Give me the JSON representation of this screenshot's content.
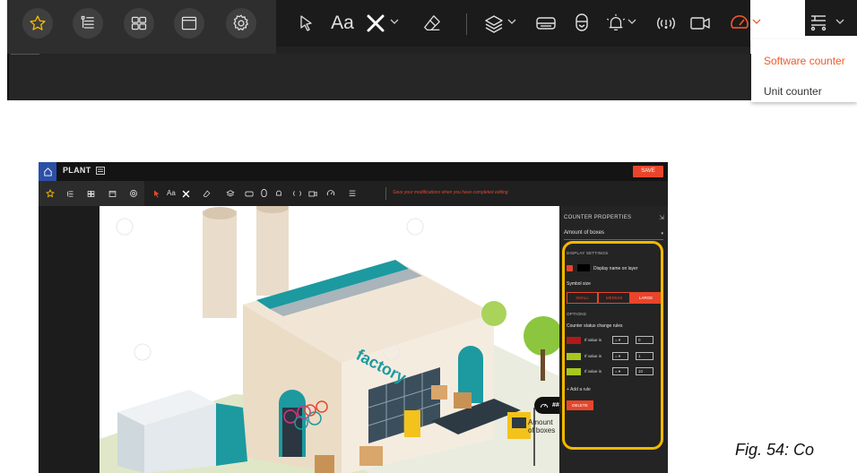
{
  "dropdown": {
    "items": [
      "Software counter",
      "Unit counter"
    ],
    "active_color": "#f15a29"
  },
  "toolbar_icons": [
    "star-icon",
    "layers-list-icon",
    "grid-icon",
    "window-icon",
    "gear-icon",
    "pointer-icon",
    "text-icon",
    "tools-icon",
    "eraser-icon",
    "layers-icon",
    "scanner-icon",
    "sensor-icon",
    "alarm-icon",
    "signal-icon",
    "camera-icon",
    "gauge-icon",
    "conveyor-icon"
  ],
  "toolbar": {
    "text_tool": "Aa"
  },
  "app": {
    "title": "PLANT",
    "save_label": "SAVE",
    "notice": "Save your modifications when you have completed editing",
    "text_tool": "Aa",
    "panel": {
      "header": "COUNTER PROPERTIES",
      "selected": "Amount of boxes",
      "display_settings": "DISPLAY SETTINGS",
      "display_name": "Display name on layer",
      "symbol_size": "Symbol size",
      "sizes": [
        "SMALL",
        "MEDIUM",
        "LARGE"
      ],
      "active_size": "LARGE",
      "options": "OPTIONS",
      "rules_label": "Counter status change rules",
      "rules": [
        {
          "color": "#b01a1a",
          "label": "If value is",
          "op": "= ▾",
          "value": "0"
        },
        {
          "color": "#a7c81c",
          "label": "If value is",
          "op": "= ▾",
          "value": "1"
        },
        {
          "color": "#a7c81c",
          "label": "If value is",
          "op": "= ▾",
          "value": "10"
        }
      ],
      "add_rule": "+ Add a rule",
      "delete": "DELETE"
    },
    "counter": {
      "value": "####",
      "name": "Amount of boxes"
    },
    "accent": "#e8452b",
    "highlight": "#f5b800"
  },
  "caption": "Fig. 54: Co"
}
